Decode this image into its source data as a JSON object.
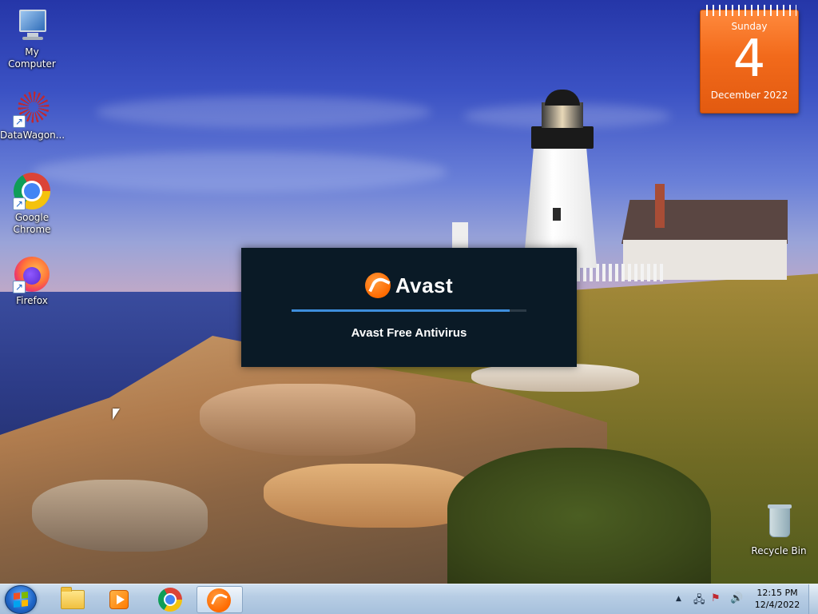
{
  "desktop": {
    "icons": [
      {
        "label": "My Computer",
        "icon": "computer-icon"
      },
      {
        "label": "DataWagon...",
        "icon": "datawagon-icon"
      },
      {
        "label": "Google Chrome",
        "icon": "chrome-icon"
      },
      {
        "label": "Firefox",
        "icon": "firefox-icon"
      },
      {
        "label": "Recycle Bin",
        "icon": "recycle-bin-icon"
      }
    ]
  },
  "calendar": {
    "weekday": "Sunday",
    "day": "4",
    "month_year": "December 2022"
  },
  "splash": {
    "brand": "Avast",
    "product": "Avast Free Antivirus",
    "progress": 0.93,
    "accent_color": "#ff7800",
    "bar_color": "#3e8edc"
  },
  "taskbar": {
    "start_icon": "windows-logo-icon",
    "pinned": [
      {
        "name": "File Explorer",
        "icon": "folder-icon"
      },
      {
        "name": "Media Player",
        "icon": "media-player-icon"
      },
      {
        "name": "Google Chrome",
        "icon": "chrome-icon"
      },
      {
        "name": "Avast",
        "icon": "avast-icon",
        "active": true
      }
    ],
    "tray": {
      "show_hidden": "▲",
      "icons": [
        "network-icon",
        "action-center-flag-icon",
        "volume-icon"
      ]
    },
    "clock": {
      "time": "12:15 PM",
      "date": "12/4/2022"
    }
  }
}
